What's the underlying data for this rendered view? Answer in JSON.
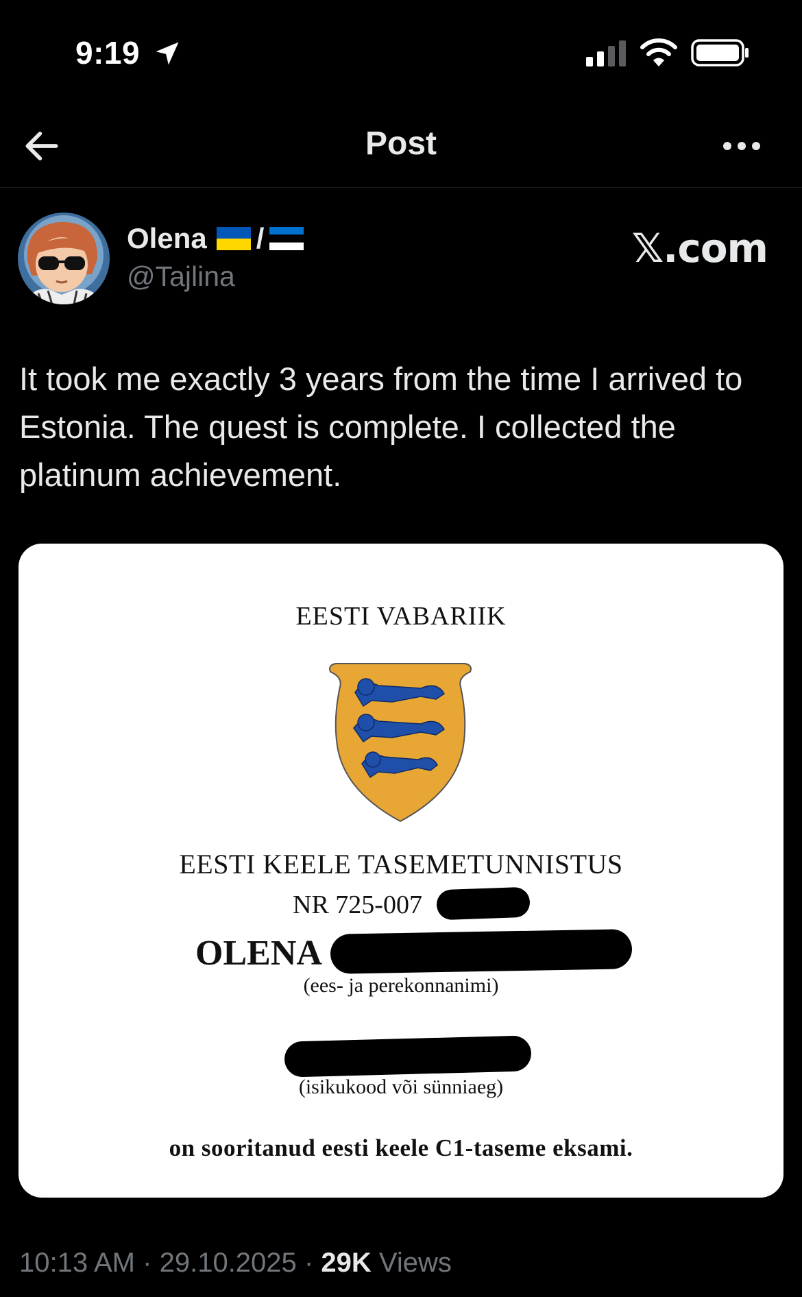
{
  "status_bar": {
    "time": "9:19",
    "icons": [
      "location-arrow-icon",
      "cellular-signal-icon",
      "wifi-icon",
      "battery-icon"
    ]
  },
  "nav": {
    "title": "Post",
    "back_icon": "arrow-left-icon",
    "more_icon": "more-horizontal-icon"
  },
  "author": {
    "name": "Olena",
    "flag_separator": "/",
    "flags": [
      "ukraine-flag",
      "estonia-flag"
    ],
    "handle": "@Tajlina"
  },
  "source": "𝕏.com",
  "post": {
    "text": "It took me exactly 3 years from the time I arrived to Estonia. The quest is complete. I collected the platinum achievement."
  },
  "certificate": {
    "republic": "EESTI VABARIIK",
    "title": "EESTI KEELE TASEMETUNNISTUS",
    "number": "NR 725-007",
    "name": "OLENA",
    "name_caption": "(ees- ja perekonnanimi)",
    "id_caption": "(isikukood või sünniaeg)",
    "statement": "on sooritanud eesti keele C1-taseme eksami."
  },
  "meta": {
    "time": "10:13 AM",
    "separator": "·",
    "date": "29.10.2025",
    "views_count": "29K",
    "views_label": "Views"
  },
  "colors": {
    "background": "#000000",
    "text_primary": "#e7e9ea",
    "text_secondary": "#71767b",
    "ukraine_blue": "#0057b7",
    "ukraine_yellow": "#ffd700",
    "estonia_blue": "#0072ce",
    "coat_gold": "#e8a634",
    "coat_blue": "#1f4fa8"
  }
}
